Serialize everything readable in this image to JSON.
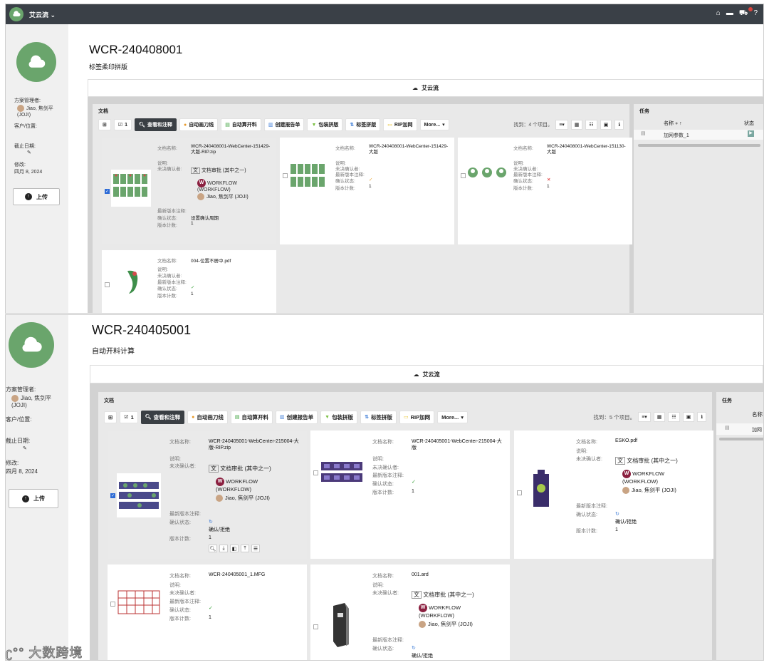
{
  "app": {
    "brand": "艾云流"
  },
  "project1": {
    "title": "WCR-240408001",
    "subtitle": "标签柔印拼版",
    "banner": "艾云流",
    "sidebar": {
      "manager_label": "方案管理者:",
      "manager_name": "Jiao, 焦剑平 (JOJI)",
      "client_label": "客户/位置:",
      "due_label": "截止日期:",
      "modified_label": "修改:",
      "modified_value": "四月 8, 2024",
      "upload": "上传"
    },
    "docs_header": "文档",
    "tasks_header": "任务",
    "toolbar": {
      "count": "1",
      "view": "查看和注释",
      "knife": "自动画刀线",
      "calc": "自动算开料",
      "report": "创建报告单",
      "pack": "包装拼版",
      "label": "标签拼版",
      "rip": "RIP加网",
      "more": "More...",
      "found": "找到：4 个项目。"
    },
    "labels": {
      "name": "文档名称:",
      "desc": "说明:",
      "pending": "未决确认者:",
      "latest": "最新版本注释:",
      "status": "确认状态:",
      "count": "版本计数:"
    },
    "cards": [
      {
        "name": "WCR-240408001-WebCenter-151429-大版-RIP.zip",
        "wf_task": "文档审批 (其中之一)",
        "wf_name": "WORKFLOW (WORKFLOW)",
        "wf_user": "Jiao, 焦剑平 (JOJI)",
        "status": "设置确认周期",
        "count": "1"
      },
      {
        "name": "WCR-240408001-WebCenter-151429-大版",
        "count": "1"
      },
      {
        "name": "WCR-240408001-WebCenter-151130-大版",
        "count": "1"
      },
      {
        "name": "004-位置不居中.pdf",
        "count": "1"
      }
    ],
    "task_cols": {
      "name": "名称",
      "status": "状态"
    },
    "task_rows": [
      {
        "name": "加网参数_1"
      }
    ]
  },
  "project2": {
    "title": "WCR-240405001",
    "subtitle": "自动开料计算",
    "banner": "艾云流",
    "sidebar": {
      "manager_label": "方案管理者:",
      "manager_name": "Jiao, 焦剑平 (JOJI)",
      "client_label": "客户/位置:",
      "due_label": "截止日期:",
      "modified_label": "修改:",
      "modified_value": "四月 8, 2024",
      "upload": "上传"
    },
    "docs_header": "文档",
    "tasks_header": "任务",
    "toolbar": {
      "count": "1",
      "view": "查看和注释",
      "knife": "自动画刀线",
      "calc": "自动算开料",
      "report": "创建报告单",
      "pack": "包装拼版",
      "label": "标签拼版",
      "rip": "RIP加网",
      "more": "More...",
      "found": "找到：5 个项目。"
    },
    "labels": {
      "name": "文档名称:",
      "desc": "说明:",
      "pending": "未决确认者:",
      "latest": "最新版本注释:",
      "status": "确认状态:",
      "count": "版本计数:"
    },
    "cards": [
      {
        "name": "WCR-240405001-WebCenter-215004-大版-RIP.zip",
        "wf_task": "文档审批 (其中之一)",
        "wf_name": "WORKFLOW (WORKFLOW)",
        "wf_user": "Jiao, 焦剑平 (JOJI)",
        "status": "确认/拒绝",
        "count": "1"
      },
      {
        "name": "WCR-240405001-WebCenter-215004-大版",
        "count": "1"
      },
      {
        "name": "ESKO.pdf",
        "wf_task": "文档审批 (其中之一)",
        "wf_name": "WORKFLOW (WORKFLOW)",
        "wf_user": "Jiao, 焦剑平 (JOJI)",
        "status": "确认/拒绝",
        "count": "1"
      },
      {
        "name": "WCR-240405001_1.MFG",
        "count": "1"
      },
      {
        "name": "001.ard",
        "wf_task": "文档审批 (其中之一)",
        "wf_name": "WORKFLOW (WORKFLOW)",
        "wf_user": "Jiao, 焦剑平 (JOJI)",
        "status": "确认/拒绝"
      }
    ],
    "task_cols": {
      "name": "名称"
    },
    "task_rows": [
      {
        "name": "加网"
      }
    ]
  },
  "watermark": "大数跨境",
  "colors": {
    "topbar": "#3a4047",
    "brand_green": "#6aa56c",
    "workflow": "#8b2040",
    "ok": "#3aa13a"
  }
}
